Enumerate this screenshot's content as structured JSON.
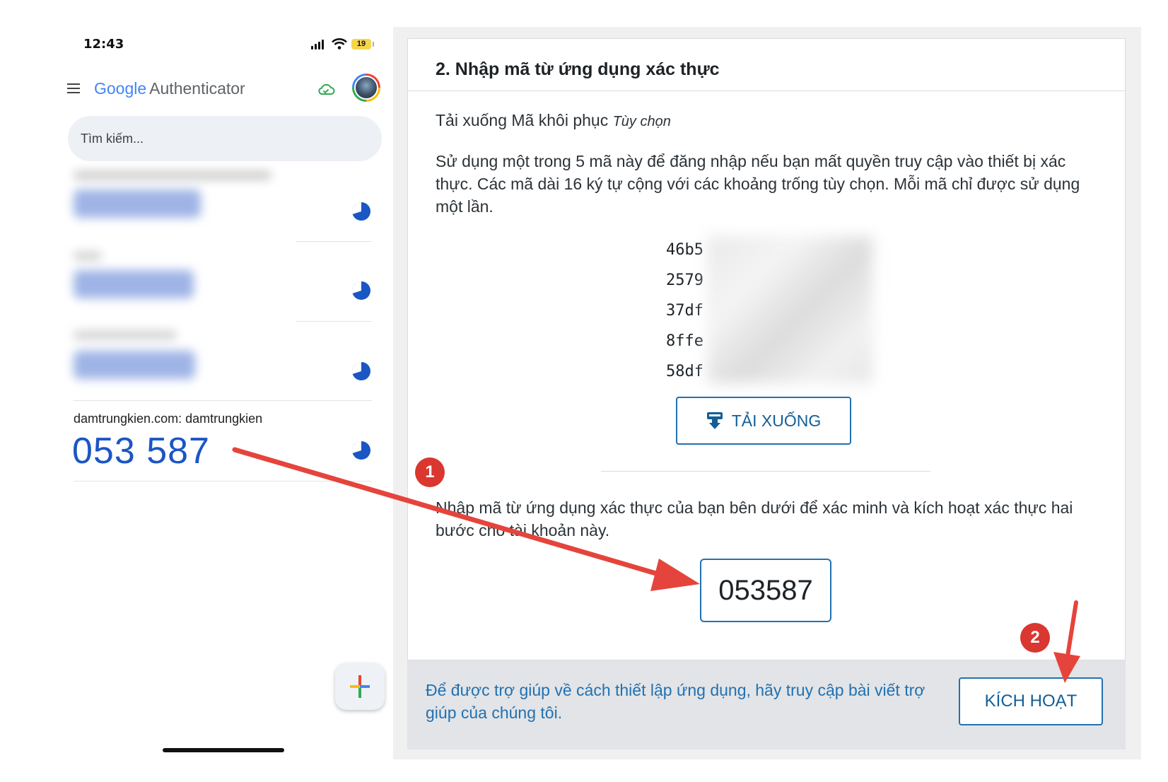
{
  "phone": {
    "status": {
      "time": "12:43",
      "battery": "19"
    },
    "app": {
      "title_google": "Google",
      "title_rest": "Authenticator"
    },
    "search": {
      "placeholder": "Tìm kiếm..."
    },
    "active_account": {
      "label": "damtrungkien.com: damtrungkien",
      "code": "053 587"
    },
    "icons": [
      "menu-icon",
      "cloud-sync-icon",
      "avatar",
      "timer-icon",
      "add-icon"
    ]
  },
  "wp": {
    "step_title": "2. Nhập mã từ ứng dụng xác thực",
    "recovery": {
      "heading": "Tải xuống Mã khôi phục",
      "optional": "Tùy chọn",
      "description": "Sử dụng một trong 5 mã này để đăng nhập nếu bạn mất quyền truy cập vào thiết bị xác thực. Các mã dài 16 ký tự cộng với các khoảng trống tùy chọn. Mỗi mã chỉ được sử dụng một lần.",
      "codes": [
        "46b5",
        "2579",
        "37df",
        "8ffe",
        "58df"
      ],
      "download_label": "TẢI XUỐNG"
    },
    "verify": {
      "instruction": "Nhập mã từ ứng dụng xác thực của bạn bên dưới để xác minh và kích hoạt xác thực hai bước cho tài khoản này.",
      "code_value": "053587"
    },
    "footer": {
      "help_text": "Để được trợ giúp về cách thiết lập ứng dụng, hãy truy cập bài viết trợ giúp của chúng tôi.",
      "activate_label": "KÍCH HOẠT"
    }
  },
  "annotations": {
    "badge1": "1",
    "badge2": "2",
    "arrow_color": "#e5443c"
  },
  "colors": {
    "wp_blue": "#2271b1",
    "otp_blue": "#1a56c4",
    "google_blue": "#4285f4",
    "google_red": "#ea4335",
    "google_yellow": "#fbbc05",
    "google_green": "#34a853"
  }
}
